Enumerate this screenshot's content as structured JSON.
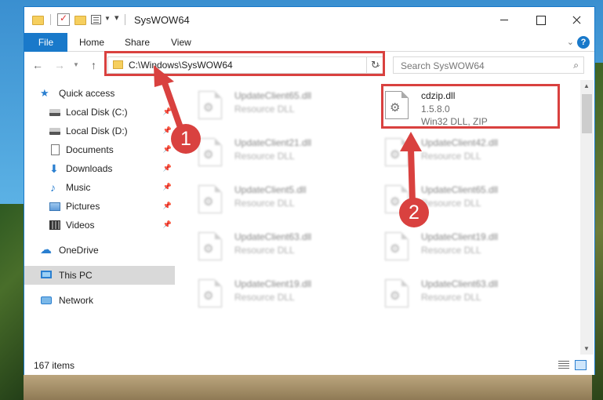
{
  "window": {
    "title": "SysWOW64",
    "ribbon_tabs": [
      "File",
      "Home",
      "Share",
      "View"
    ],
    "help_label": "?"
  },
  "nav": {
    "address": "C:\\Windows\\SysWOW64",
    "search_placeholder": "Search SysWOW64"
  },
  "sidebar": {
    "items": [
      {
        "label": "Quick access",
        "icon": "star-icon",
        "pinned": false
      },
      {
        "label": "Local Disk (C:)",
        "icon": "drive-icon",
        "pinned": true
      },
      {
        "label": "Local Disk (D:)",
        "icon": "drive-icon",
        "pinned": true
      },
      {
        "label": "Documents",
        "icon": "documents-icon",
        "pinned": true
      },
      {
        "label": "Downloads",
        "icon": "download-icon",
        "pinned": true
      },
      {
        "label": "Music",
        "icon": "music-icon",
        "pinned": true
      },
      {
        "label": "Pictures",
        "icon": "pictures-icon",
        "pinned": true
      },
      {
        "label": "Videos",
        "icon": "videos-icon",
        "pinned": true
      },
      {
        "label": "OneDrive",
        "icon": "onedrive-icon",
        "pinned": false
      },
      {
        "label": "This PC",
        "icon": "this-pc-icon",
        "pinned": false,
        "selected": true
      },
      {
        "label": "Network",
        "icon": "network-icon",
        "pinned": false
      }
    ]
  },
  "files": [
    {
      "name": "UpdateClient65.dll",
      "type": "Resource DLL",
      "blurred": true
    },
    {
      "name": "cdzip.dll",
      "version": "1.5.8.0",
      "type": "Win32 DLL, ZIP",
      "blurred": false
    },
    {
      "name": "UpdateClient21.dll",
      "type": "Resource DLL",
      "blurred": true
    },
    {
      "name": "UpdateClient42.dll",
      "type": "Resource DLL",
      "blurred": true
    },
    {
      "name": "UpdateClient5.dll",
      "type": "Resource DLL",
      "blurred": true
    },
    {
      "name": "UpdateClient65.dll",
      "type": "Resource DLL",
      "blurred": true
    },
    {
      "name": "UpdateClient63.dll",
      "type": "Resource DLL",
      "blurred": true
    },
    {
      "name": "UpdateClient19.dll",
      "type": "Resource DLL",
      "blurred": true
    },
    {
      "name": "UpdateClient19.dll",
      "type": "Resource DLL",
      "blurred": true
    },
    {
      "name": "UpdateClient63.dll",
      "type": "Resource DLL",
      "blurred": true
    }
  ],
  "status": {
    "item_count": "167 items"
  },
  "annotations": {
    "step1": "1",
    "step2": "2",
    "color": "#d9413f"
  }
}
